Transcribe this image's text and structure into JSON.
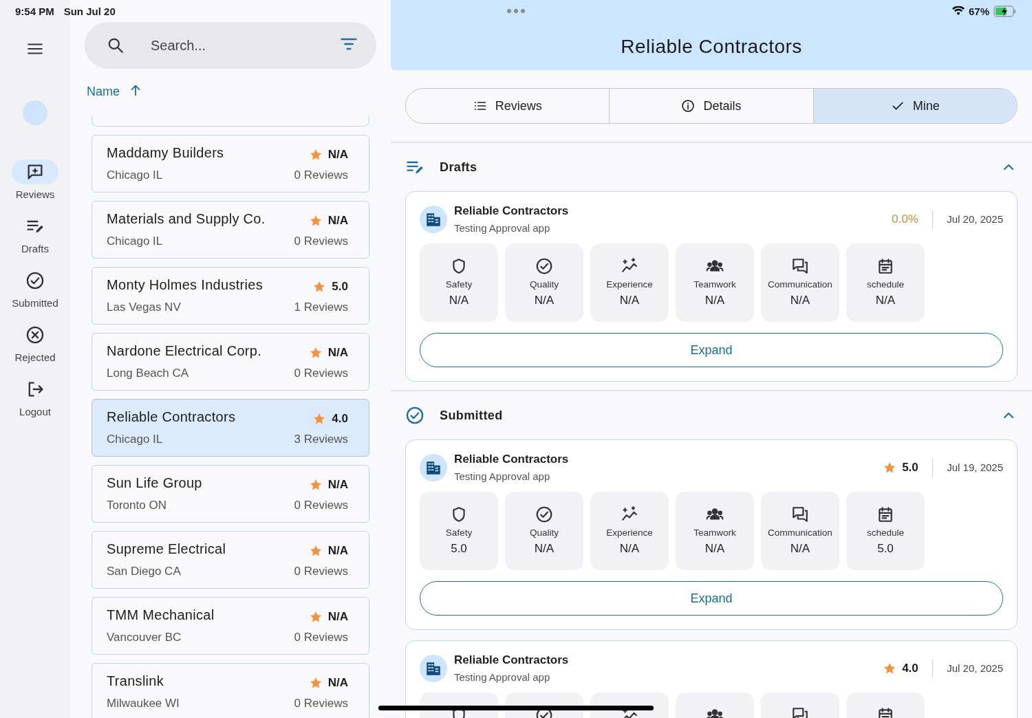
{
  "status_bar": {
    "time": "9:54 PM",
    "date": "Sun Jul 20",
    "battery": "67%"
  },
  "rail": {
    "items": [
      {
        "kind": "reviews",
        "label": "Reviews",
        "selected": true
      },
      {
        "kind": "drafts",
        "label": "Drafts",
        "selected": false
      },
      {
        "kind": "submitted",
        "label": "Submitted",
        "selected": false
      },
      {
        "kind": "rejected",
        "label": "Rejected",
        "selected": false
      },
      {
        "kind": "logout",
        "label": "Logout",
        "selected": false
      }
    ]
  },
  "search": {
    "placeholder": "Search..."
  },
  "sort": {
    "label": "Name"
  },
  "contractors": [
    {
      "name": "Maddamy Builders",
      "location": "Chicago IL",
      "rating": "N/A",
      "reviews": "0 Reviews",
      "selected": false
    },
    {
      "name": "Materials and Supply Co.",
      "location": "Chicago IL",
      "rating": "N/A",
      "reviews": "0 Reviews",
      "selected": false
    },
    {
      "name": "Monty Holmes Industries",
      "location": "Las Vegas NV",
      "rating": "5.0",
      "reviews": "1 Reviews",
      "selected": false
    },
    {
      "name": "Nardone Electrical Corp.",
      "location": "Long Beach CA",
      "rating": "N/A",
      "reviews": "0 Reviews",
      "selected": false
    },
    {
      "name": "Reliable Contractors",
      "location": "Chicago IL",
      "rating": "4.0",
      "reviews": "3 Reviews",
      "selected": true
    },
    {
      "name": "Sun Life Group",
      "location": "Toronto ON",
      "rating": "N/A",
      "reviews": "0 Reviews",
      "selected": false
    },
    {
      "name": "Supreme Electrical",
      "location": "San Diego CA",
      "rating": "N/A",
      "reviews": "0 Reviews",
      "selected": false
    },
    {
      "name": "TMM Mechanical",
      "location": "Vancouver BC",
      "rating": "N/A",
      "reviews": "0 Reviews",
      "selected": false
    },
    {
      "name": "Translink",
      "location": "Milwaukee WI",
      "rating": "N/A",
      "reviews": "0 Reviews",
      "selected": false
    }
  ],
  "detail": {
    "title": "Reliable Contractors",
    "tabs": [
      {
        "kind": "list",
        "label": "Reviews",
        "selected": false
      },
      {
        "kind": "info",
        "label": "Details",
        "selected": false
      },
      {
        "kind": "check",
        "label": "Mine",
        "selected": true
      }
    ],
    "sections": [
      {
        "kind": "drafts",
        "title": "Drafts",
        "expanded": true,
        "reviews": [
          {
            "name": "Reliable Contractors",
            "subtitle": "Testing Approval app",
            "score": {
              "kind": "percent",
              "value": "0.0%"
            },
            "date": "Jul 20, 2025",
            "button": "Expand",
            "metrics": [
              {
                "kind": "safety",
                "label": "Safety",
                "value": "N/A"
              },
              {
                "kind": "quality",
                "label": "Quality",
                "value": "N/A"
              },
              {
                "kind": "experience",
                "label": "Experience",
                "value": "N/A"
              },
              {
                "kind": "teamwork",
                "label": "Teamwork",
                "value": "N/A"
              },
              {
                "kind": "communication",
                "label": "Communication",
                "value": "N/A"
              },
              {
                "kind": "schedule",
                "label": "schedule",
                "value": "N/A"
              }
            ]
          }
        ]
      },
      {
        "kind": "submitted",
        "title": "Submitted",
        "expanded": true,
        "reviews": [
          {
            "name": "Reliable Contractors",
            "subtitle": "Testing Approval app",
            "score": {
              "kind": "stars",
              "value": "5.0"
            },
            "date": "Jul 19, 2025",
            "button": "Expand",
            "metrics": [
              {
                "kind": "safety",
                "label": "Safety",
                "value": "5.0"
              },
              {
                "kind": "quality",
                "label": "Quality",
                "value": "N/A"
              },
              {
                "kind": "experience",
                "label": "Experience",
                "value": "N/A"
              },
              {
                "kind": "teamwork",
                "label": "Teamwork",
                "value": "N/A"
              },
              {
                "kind": "communication",
                "label": "Communication",
                "value": "N/A"
              },
              {
                "kind": "schedule",
                "label": "schedule",
                "value": "5.0"
              }
            ]
          },
          {
            "name": "Reliable Contractors",
            "subtitle": "Testing Approval app",
            "score": {
              "kind": "stars",
              "value": "4.0"
            },
            "date": "Jul 20, 2025",
            "metrics": [
              {
                "kind": "safety"
              },
              {
                "kind": "quality"
              },
              {
                "kind": "experience"
              },
              {
                "kind": "teamwork"
              },
              {
                "kind": "communication"
              },
              {
                "kind": "schedule"
              }
            ]
          }
        ]
      }
    ]
  }
}
